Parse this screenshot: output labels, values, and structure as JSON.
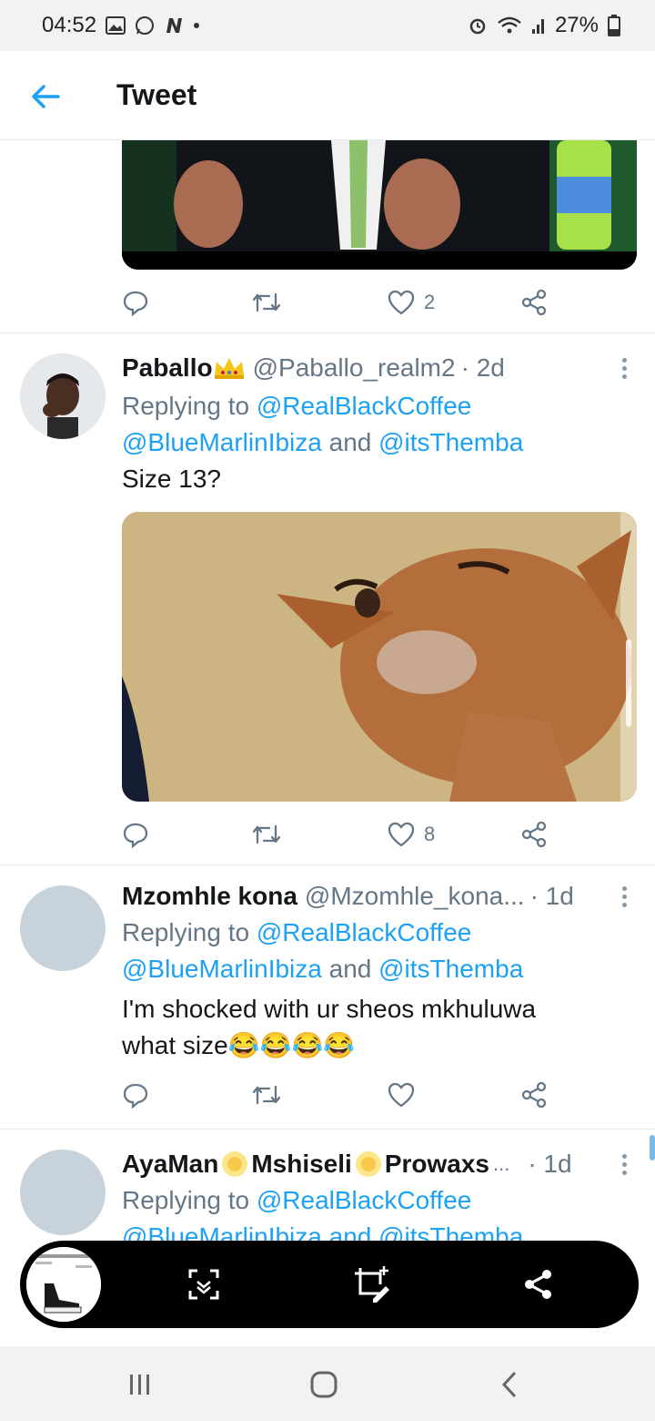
{
  "status_bar": {
    "time": "04:52",
    "battery": "27%"
  },
  "header": {
    "title": "Tweet"
  },
  "tweets": [
    {
      "likes": "2"
    },
    {
      "name": "Paballo",
      "handle": "@Paballo_realm2",
      "time": "· 2d",
      "replying_prefix": "Replying to ",
      "mention_1": "@RealBlackCoffee",
      "mention_2": "@BlueMarlinIbiza",
      "and_text": " and ",
      "mention_3": "@itsThemba",
      "text": "Size 13?",
      "likes": "8"
    },
    {
      "name": "Mzomhle kona",
      "handle": "@Mzomhle_kona...",
      "time": "· 1d",
      "replying_prefix": "Replying to ",
      "mention_1": "@RealBlackCoffee",
      "mention_2": "@BlueMarlinIbiza",
      "and_text": " and ",
      "mention_3": "@itsThemba",
      "text_1": "I'm shocked with ur sheos mkhuluwa",
      "text_2": "what size",
      "emojis": "😂😂😂😂"
    },
    {
      "name_1": "AyaMan",
      "name_2": "Mshiseli",
      "name_3": "Prowaxs",
      "name_ellipsis": "...",
      "time": "· 1d",
      "replying_prefix": "Replying to ",
      "mention_1": "@RealBlackCoffee",
      "mention_2": "@BlueMarlinIbiza and @itsThemba"
    }
  ],
  "icons": {
    "back": "arrow-left-icon",
    "reply": "reply-icon",
    "retweet": "retweet-icon",
    "like": "heart-icon",
    "share": "share-icon",
    "more": "more-vertical-icon",
    "scroll_capture": "scroll-capture-icon",
    "edit": "crop-edit-icon",
    "recents": "recents-icon",
    "home": "home-icon",
    "nav_back": "nav-back-icon"
  },
  "colors": {
    "accent": "#1da1f2",
    "secondary_text": "#657786",
    "primary_text": "#14171a"
  }
}
